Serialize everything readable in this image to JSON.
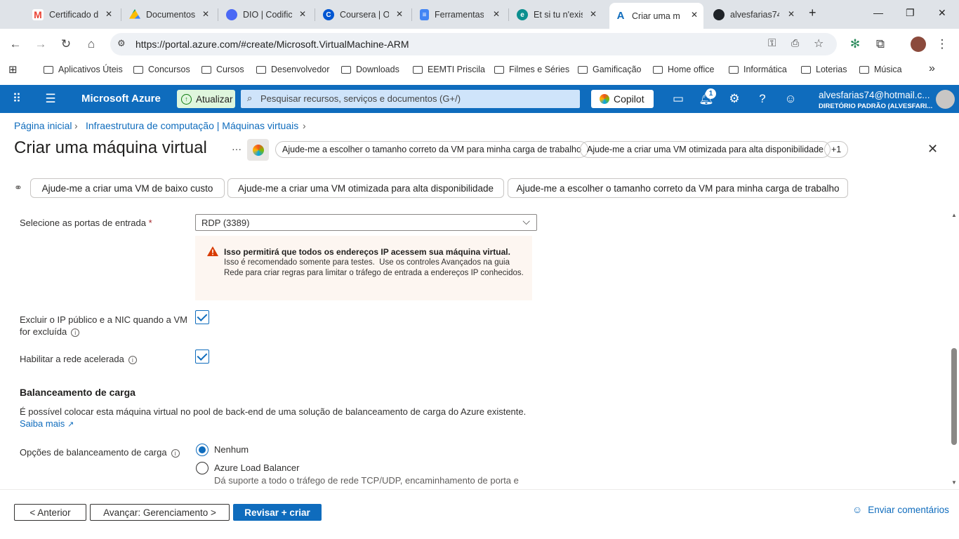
{
  "browser": {
    "tabs": [
      {
        "title": "Certificado d",
        "icon": "gmail-icon",
        "color": "#ea4335"
      },
      {
        "title": "Documentos",
        "icon": "google-drive-icon",
        "color": "#1a73e8"
      },
      {
        "title": "DIO | Codific",
        "icon": "dio-icon",
        "color": "#4a68f5"
      },
      {
        "title": "Coursera | O",
        "icon": "coursera-icon",
        "color": "#0056d2"
      },
      {
        "title": "Ferramentas",
        "icon": "google-docs-icon",
        "color": "#4285f4"
      },
      {
        "title": "Et si tu n'exis",
        "icon": "edge-icon",
        "color": "#0c8f8f"
      },
      {
        "title": "Criar uma m",
        "icon": "azure-icon",
        "color": "#0f6cbd"
      },
      {
        "title": "alvesfarias74",
        "icon": "github-icon",
        "color": "#1f2328"
      }
    ],
    "url": "https://portal.azure.com/#create/Microsoft.VirtualMachine-ARM",
    "bookmarks": [
      "Aplicativos Úteis",
      "Concursos",
      "Cursos",
      "Desenvolvedor",
      "Downloads",
      "EEMTI Priscila",
      "Filmes e Séries",
      "Gamificação",
      "Home office",
      "Informática",
      "Loterias",
      "Música"
    ]
  },
  "azure": {
    "brand": "Microsoft Azure",
    "upgrade_label": "Atualizar",
    "search_placeholder": "Pesquisar recursos, serviços e documentos (G+/)",
    "copilot_label": "Copilot",
    "notification_count": "1",
    "user_email": "alvesfarias74@hotmail.c...",
    "user_directory": "DIRETÓRIO PADRÃO (ALVESFARI..."
  },
  "page": {
    "breadcrumb": [
      "Página inicial",
      "Infraestrutura de computação | Máquinas virtuais"
    ],
    "title": "Criar uma máquina virtual",
    "ellipsis": "···",
    "copilot_suggestions": [
      "Ajude-me a escolher o tamanho correto da VM para minha carga de trabalho",
      "Ajude-me a criar uma VM otimizada para alta disponibilidade",
      "+1"
    ],
    "suggestion_buttons": [
      "Ajude-me a criar uma VM de baixo custo",
      "Ajude-me a criar uma VM otimizada para alta disponibilidade",
      "Ajude-me a escolher o tamanho correto da VM para minha carga de trabalho"
    ]
  },
  "form": {
    "inbound_ports_label": "Selecione as portas de entrada",
    "required_mark": "*",
    "inbound_ports_value": "RDP (3389)",
    "warning_title": "Isso permitirá que todos os endereços IP acessem sua máquina virtual.",
    "warning_body": "Isso é recomendado somente para testes.  Use os controles Avançados na guia Rede para criar regras para limitar o tráfego de entrada a endereços IP conhecidos.",
    "delete_ip_label_line1": "Excluir o IP público e a NIC quando a VM",
    "delete_ip_label_line2": "for excluída",
    "delete_ip_checked": true,
    "accel_label": "Habilitar a rede acelerada",
    "accel_checked": true,
    "lb_heading": "Balanceamento de carga",
    "lb_description": "É possível colocar esta máquina virtual no pool de back-end de uma solução de balanceamento de carga do Azure existente.",
    "lb_learn_more": "Saiba mais",
    "lb_options_label": "Opções de balanceamento de carga",
    "lb_options": [
      {
        "label": "Nenhum",
        "selected": true
      },
      {
        "label": "Azure Load Balancer",
        "selected": false
      }
    ],
    "lb_option2_desc": "Dá suporte a todo o tráfego de rede TCP/UDP, encaminhamento de porta e"
  },
  "footer": {
    "prev_label": "< Anterior",
    "next_label": "Avançar: Gerenciamento >",
    "review_label": "Revisar + criar",
    "feedback_label": "Enviar comentários"
  }
}
